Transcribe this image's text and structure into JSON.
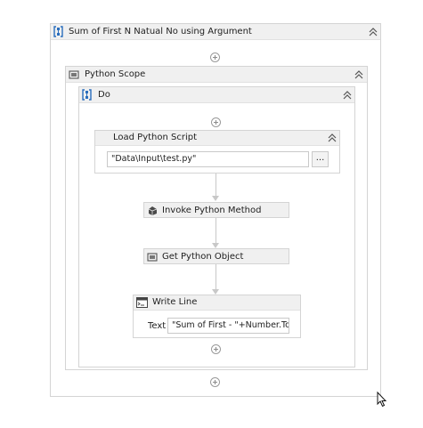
{
  "sequence": {
    "title": "Sum of First N Natual No using Argument",
    "collapse_icon": "double-chevron-up-icon"
  },
  "python_scope": {
    "title": "Python Scope"
  },
  "do_block": {
    "title": "Do"
  },
  "load_script": {
    "title": "Load Python Script",
    "file_value": "\"Data\\Input\\test.py\"",
    "browse_label": "..."
  },
  "invoke_method": {
    "title": "Invoke Python Method"
  },
  "get_object": {
    "title": "Get Python Object"
  },
  "write_line": {
    "title": "Write Line",
    "text_label": "Text",
    "text_value": "\"Sum of First - \"+Number.ToS"
  }
}
